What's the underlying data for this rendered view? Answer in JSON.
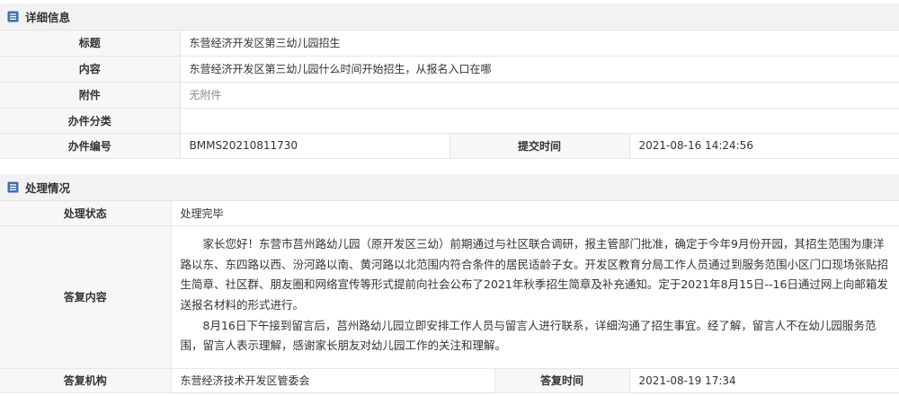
{
  "detail": {
    "header": "详细信息",
    "rows": {
      "title_label": "标题",
      "title_value": "东营经济开发区第三幼儿园招生",
      "content_label": "内容",
      "content_value": "东营经济开发区第三幼儿园什么时间开始招生，从报名入口在哪",
      "attachment_label": "附件",
      "attachment_value": "无附件",
      "category_label": "办件分类",
      "category_value": "",
      "number_label": "办件编号",
      "number_value": "BMMS20210811730",
      "submit_time_label": "提交时间",
      "submit_time_value": "2021-08-16 14:24:56"
    }
  },
  "processing": {
    "header": "处理情况",
    "rows": {
      "status_label": "处理状态",
      "status_value": "处理完毕",
      "reply_label": "答复内容",
      "reply_paragraph_1": "家长您好！东营市莒州路幼儿园（原开发区三幼）前期通过与社区联合调研，报主管部门批准，确定于今年9月份开园，其招生范围为康洋路以东、东四路以西、汾河路以南、黄河路以北范围内符合条件的居民适龄子女。开发区教育分局工作人员通过到服务范围小区门口现场张贴招生简章、社区群、朋友圈和网络宣传等形式提前向社会公布了2021年秋季招生简章及补充通知。定于2021年8月15日--16日通过网上向邮箱发送报名材料的形式进行。",
      "reply_paragraph_2": "8月16日下午接到留言后，莒州路幼儿园立即安排工作人员与留言人进行联系，详细沟通了招生事宜。经了解，留言人不在幼儿园服务范围，留言人表示理解，感谢家长朋友对幼儿园工作的关注和理解。",
      "org_label": "答复机构",
      "org_value": "东营经济技术开发区管委会",
      "reply_time_label": "答复时间",
      "reply_time_value": "2021-08-19 17:34"
    }
  },
  "colors": {
    "header_icon": "#3f6fb5",
    "label_bg": "#f7f7f7",
    "header_bg": "#f2f2f2"
  },
  "icons": [
    "list-doc-icon",
    "list-doc-icon"
  ]
}
